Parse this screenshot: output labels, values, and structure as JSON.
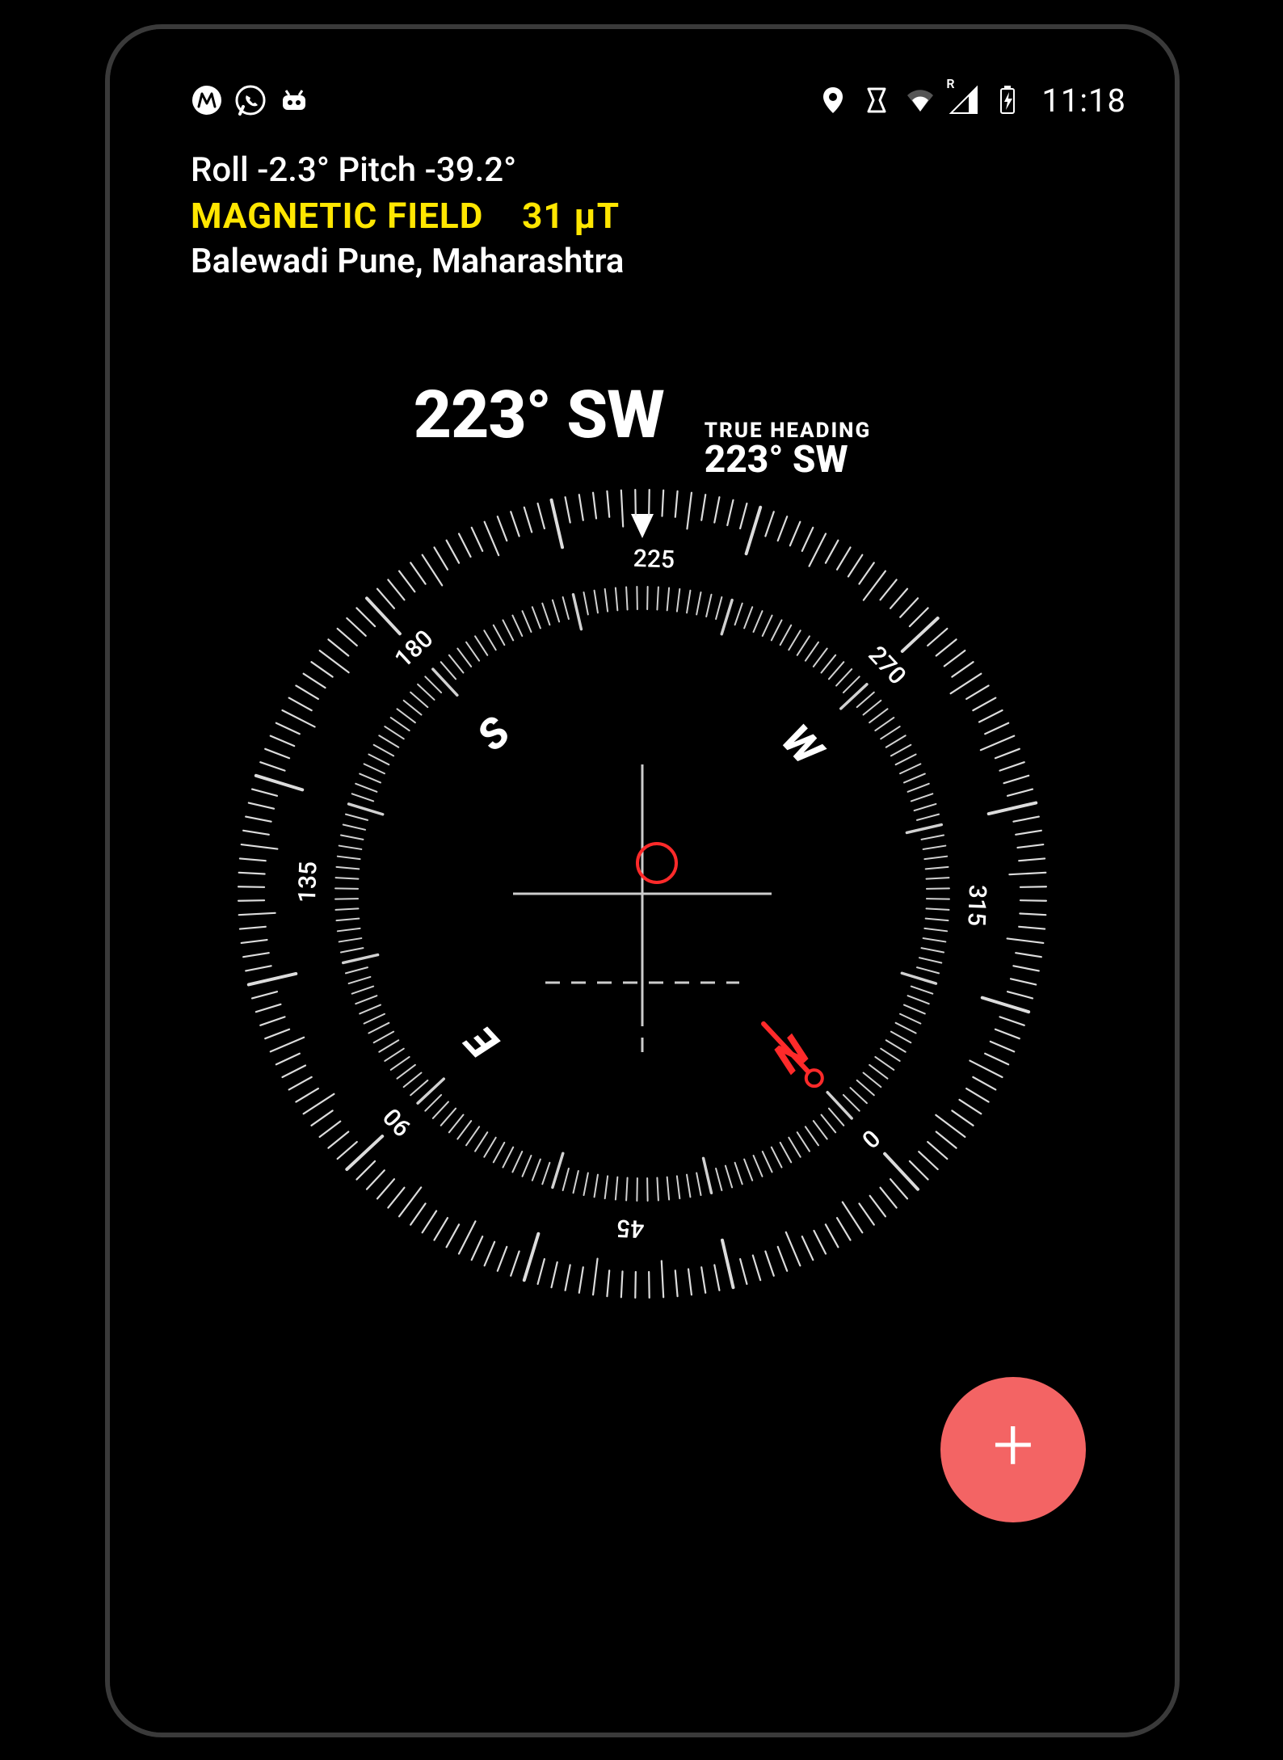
{
  "status_bar": {
    "clock": "11:18",
    "left_icons": [
      "app-m-icon",
      "whatsapp-icon",
      "robot-icon"
    ],
    "right_icons": [
      "location-icon",
      "dnd-icon",
      "wifi-icon",
      "cell-signal-icon",
      "battery-charging-icon"
    ],
    "roaming_indicator": "R"
  },
  "sensor": {
    "roll_label": "Roll",
    "roll_value": "-2.3°",
    "pitch_label": "Pitch",
    "pitch_value": "-39.2°",
    "magnetic_label": "MAGNETIC FIELD",
    "magnetic_value": "31 μT",
    "location": "Balewadi Pune, Maharashtra"
  },
  "heading": {
    "main_value": "223°",
    "main_dir": "SW",
    "true_label": "TRUE HEADING",
    "true_value": "223°",
    "true_dir": "SW",
    "heading_deg": 223
  },
  "compass": {
    "cardinals": [
      "N",
      "E",
      "S",
      "W"
    ],
    "major_labels": [
      0,
      45,
      90,
      135,
      180,
      225,
      270,
      315
    ],
    "colors": {
      "north": "#ff2a2a",
      "tick": "#e8e8e8",
      "label": "#ffffff"
    }
  },
  "fab": {
    "symbol": "+"
  }
}
